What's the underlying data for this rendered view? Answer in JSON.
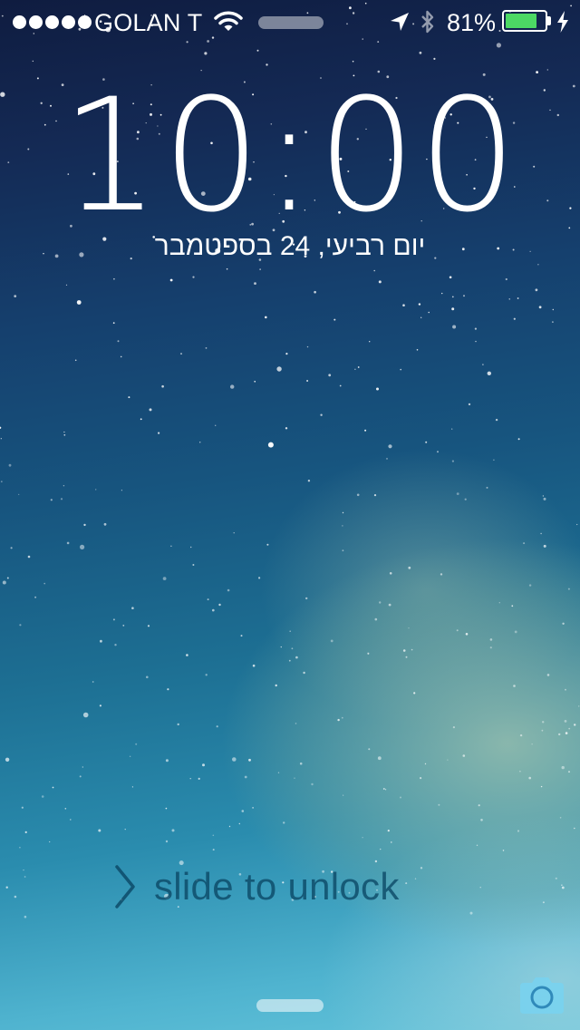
{
  "status_bar": {
    "signal_bars_filled": 5,
    "carrier": "GOLAN T",
    "wifi_icon": "wifi-icon",
    "location_icon": "location-arrow-icon",
    "bluetooth_icon": "bluetooth-icon",
    "battery_percent_label": "81%",
    "battery_level": 0.81,
    "battery_color": "#4cd964",
    "charging_icon": "bolt-icon"
  },
  "lock_screen": {
    "time": "10:00",
    "date": "יום רביעי, 24 בספטמבר",
    "unlock_label": "slide to unlock",
    "unlock_icon": "chevron-right-icon",
    "camera_icon": "camera-icon"
  }
}
